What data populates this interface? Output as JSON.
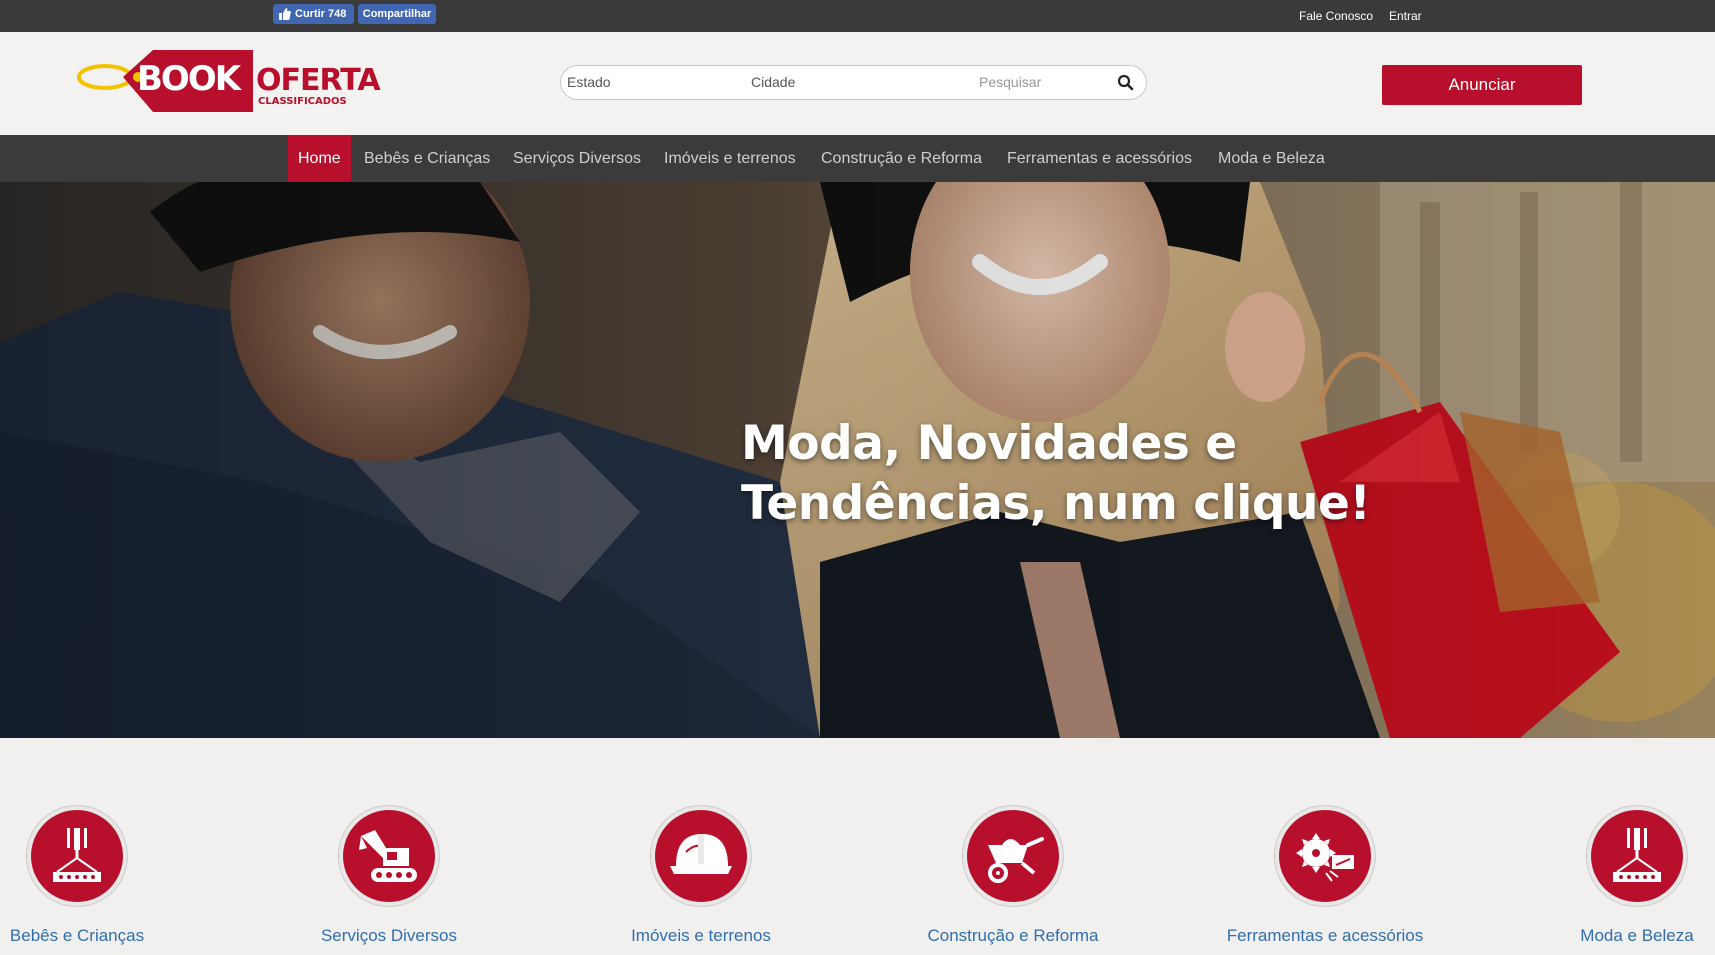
{
  "topbar": {
    "like_label": "Curtir 748",
    "share_label": "Compartilhar",
    "contact_label": "Fale Conosco",
    "login_label": "Entrar"
  },
  "header": {
    "logo_book": "BOOK",
    "logo_oferta": "OFERTA",
    "logo_sub": "CLASSIFICADOS",
    "estado_placeholder": "Estado",
    "cidade_placeholder": "Cidade",
    "search_placeholder": "Pesquisar",
    "announce_label": "Anunciar"
  },
  "nav": {
    "items": [
      "Home",
      "Bebês e Crianças",
      "Serviços Diversos",
      "Imóveis e terrenos",
      "Construção e Reforma",
      "Ferramentas e acessórios",
      "Moda e Beleza"
    ],
    "active": "Home"
  },
  "hero": {
    "line1": "Moda, Novidades e",
    "line2": "Tendências, num clique!"
  },
  "categories": [
    {
      "label": "Bebês e Crianças",
      "icon": "crane-hook-icon"
    },
    {
      "label": "Serviços Diversos",
      "icon": "excavator-icon"
    },
    {
      "label": "Imóveis e terrenos",
      "icon": "hard-hat-icon"
    },
    {
      "label": "Construção e Reforma",
      "icon": "wheelbarrow-icon"
    },
    {
      "label": "Ferramentas e acessórios",
      "icon": "saw-blade-icon"
    },
    {
      "label": "Moda e Beleza",
      "icon": "crane-hook-icon"
    }
  ],
  "colors": {
    "brand_red": "#b8102c",
    "topbar": "#3a3a3a",
    "nav": "#3b3b3b",
    "facebook": "#4267b2",
    "link_blue": "#2f6fae",
    "logo_yellow": "#f2c200"
  }
}
